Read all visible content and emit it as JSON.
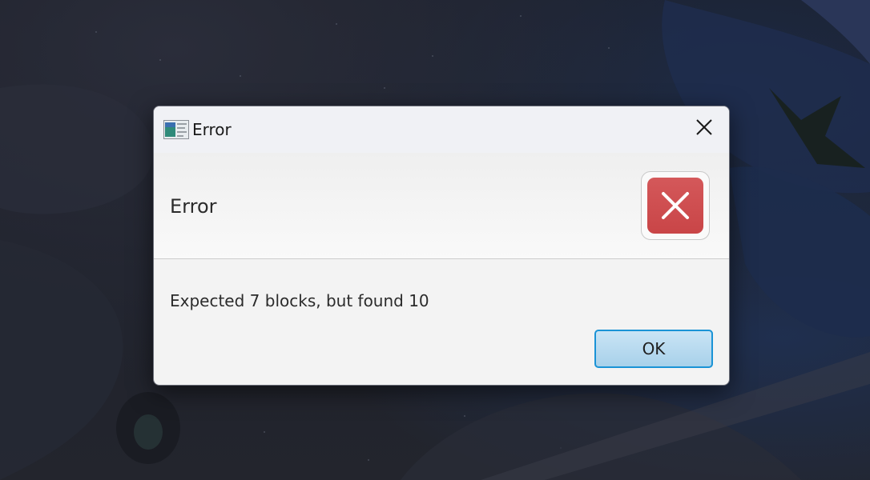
{
  "window": {
    "title": "Error",
    "app_icon": "java-app-icon",
    "close_icon": "close-icon"
  },
  "header": {
    "title": "Error",
    "icon": "error-icon",
    "icon_color": "#cf4e50"
  },
  "content": {
    "message": "Expected 7 blocks, but found 10"
  },
  "buttons": {
    "ok_label": "OK",
    "ok_border_color": "#1a93d6"
  }
}
